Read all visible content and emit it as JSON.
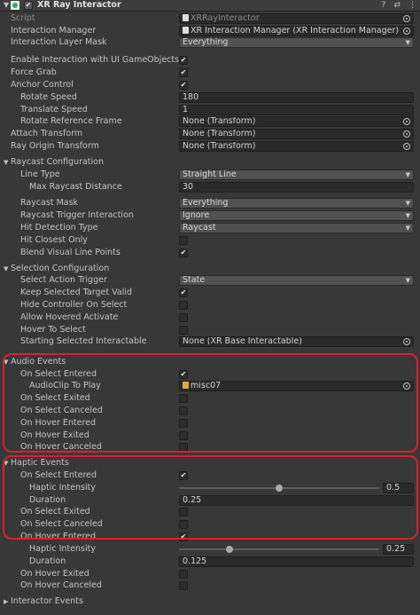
{
  "header": {
    "fold_glyph": "▼",
    "check_glyph": "✔",
    "title": "XR Ray Interactor",
    "help_icon": "?",
    "preset_icon": "⇄",
    "menu_icon": "⋮"
  },
  "glyphs": {
    "check": "✔",
    "caret": "▼",
    "fold_open": "▼",
    "fold_closed": "▶"
  },
  "properties": {
    "script_label": "Script",
    "script_value": "XRRayInteractor",
    "interaction_manager_label": "Interaction Manager",
    "interaction_manager_value": "XR Interaction Manager (XR Interaction Manager)",
    "interaction_layer_mask_label": "Interaction Layer Mask",
    "interaction_layer_mask_value": "Everything",
    "enable_ui_label": "Enable Interaction with UI GameObjects",
    "force_grab_label": "Force Grab",
    "anchor_control_label": "Anchor Control",
    "rotate_speed_label": "Rotate Speed",
    "rotate_speed_value": "180",
    "translate_speed_label": "Translate Speed",
    "translate_speed_value": "1",
    "rotate_ref_frame_label": "Rotate Reference Frame",
    "rotate_ref_frame_value": "None (Transform)",
    "attach_transform_label": "Attach Transform",
    "attach_transform_value": "None (Transform)",
    "ray_origin_label": "Ray Origin Transform",
    "ray_origin_value": "None (Transform)"
  },
  "raycast": {
    "section_label": "Raycast Configuration",
    "line_type_label": "Line Type",
    "line_type_value": "Straight Line",
    "max_distance_label": "Max Raycast Distance",
    "max_distance_value": "30",
    "raycast_mask_label": "Raycast Mask",
    "raycast_mask_value": "Everything",
    "trigger_interaction_label": "Raycast Trigger Interaction",
    "trigger_interaction_value": "Ignore",
    "hit_detection_label": "Hit Detection Type",
    "hit_detection_value": "Raycast",
    "hit_closest_label": "Hit Closest Only",
    "blend_visual_label": "Blend Visual Line Points"
  },
  "selection": {
    "section_label": "Selection Configuration",
    "select_trigger_label": "Select Action Trigger",
    "select_trigger_value": "State",
    "keep_selected_label": "Keep Selected Target Valid",
    "hide_controller_label": "Hide Controller On Select",
    "allow_hovered_label": "Allow Hovered Activate",
    "hover_to_select_label": "Hover To Select",
    "starting_selected_label": "Starting Selected Interactable",
    "starting_selected_value": "None (XR Base Interactable)"
  },
  "audio": {
    "section_label": "Audio Events",
    "on_select_entered_label": "On Select Entered",
    "audioclip_label": "AudioClip To Play",
    "audioclip_value": "misc07",
    "on_select_exited_label": "On Select Exited",
    "on_select_canceled_label": "On Select Canceled",
    "on_hover_entered_label": "On Hover Entered",
    "on_hover_exited_label": "On Hover Exited",
    "on_hover_canceled_label": "On Hover Canceled"
  },
  "haptic": {
    "section_label": "Haptic Events",
    "on_select_entered_label": "On Select Entered",
    "select_intensity_label": "Haptic Intensity",
    "select_intensity_value": "0.5",
    "select_intensity_level": 0.5,
    "select_duration_label": "Duration",
    "select_duration_value": "0.25",
    "on_select_exited_label": "On Select Exited",
    "on_select_canceled_label": "On Select Canceled",
    "on_hover_entered_label": "On Hover Entered",
    "hover_intensity_label": "Haptic Intensity",
    "hover_intensity_value": "0.25",
    "hover_intensity_level": 0.25,
    "hover_duration_label": "Duration",
    "hover_duration_value": "0.125",
    "on_hover_exited_label": "On Hover Exited",
    "on_hover_canceled_label": "On Hover Canceled"
  },
  "interactor_events": {
    "section_label": "Interactor Events"
  },
  "colors": {
    "highlight": "#d9212c",
    "panel": "#383838"
  }
}
